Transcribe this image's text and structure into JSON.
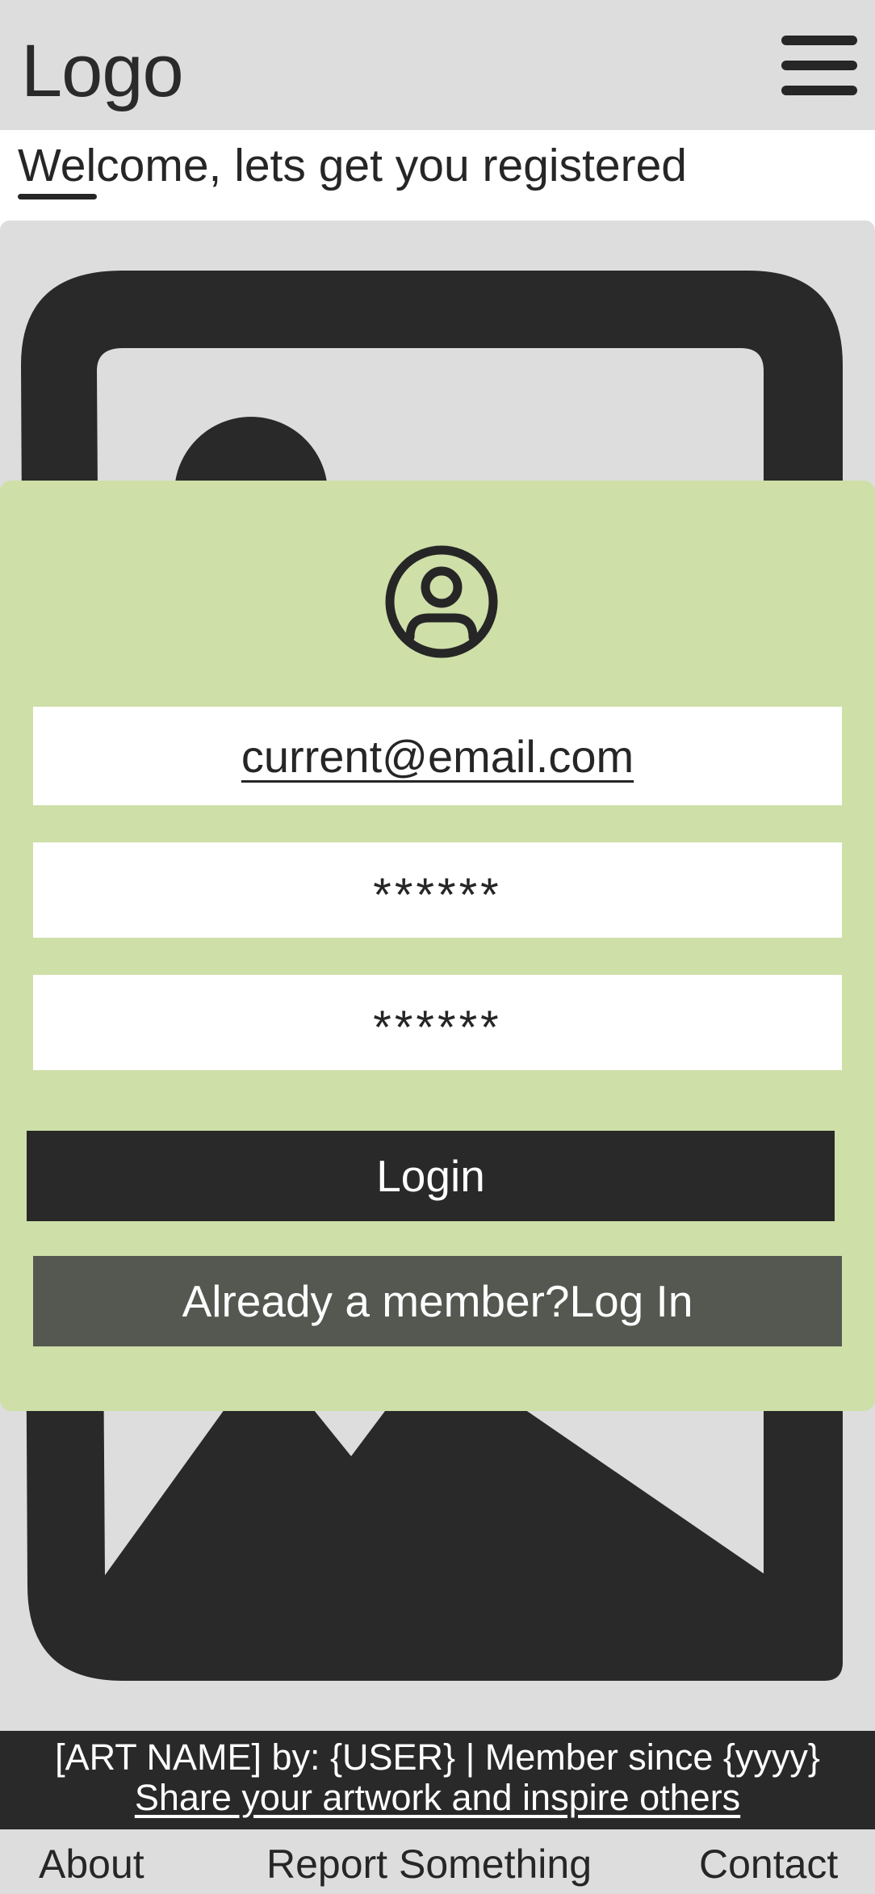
{
  "header": {
    "logo": "Logo",
    "menu_icon": "hamburger-menu-icon"
  },
  "welcome": {
    "text": "Welcome, lets get you registered"
  },
  "hero": {
    "image_icon": "image-placeholder-icon"
  },
  "form": {
    "avatar_icon": "user-avatar-icon",
    "email_value": "current@email.com",
    "password_value": "******",
    "confirm_password_value": "******",
    "login_label": "Login",
    "member_label": "Already a member?Log In"
  },
  "footer": {
    "credit": "[ART NAME] by: {USER} | Member since {yyyy}",
    "share_link": "Share your artwork and inspire others"
  },
  "nav": {
    "about": "About",
    "report": "Report Something",
    "contact": "Contact"
  },
  "colors": {
    "header_bg": "#dcdddc",
    "card_bg": "#cfdfa8",
    "dark": "#292929",
    "secondary_button": "#545850"
  }
}
